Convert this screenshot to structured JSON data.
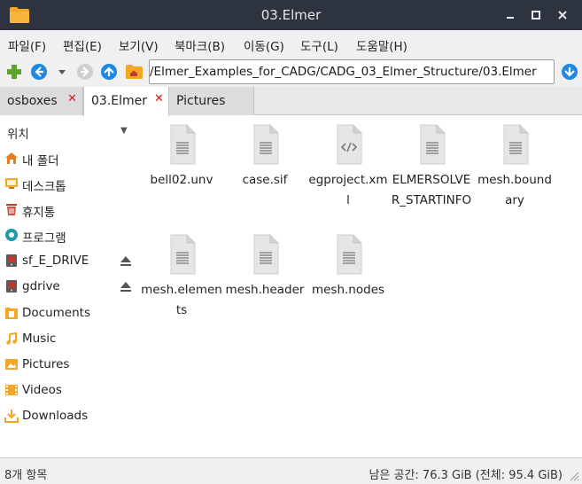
{
  "window": {
    "title": "03.Elmer"
  },
  "menu": [
    "파일(F)",
    "편집(E)",
    "보기(V)",
    "북마크(B)",
    "이동(G)",
    "도구(L)",
    "도움말(H)"
  ],
  "path": {
    "value": "/Elmer_Examples_for_CADG/CADG_03_Elmer_Structure/03.Elmer"
  },
  "tabs": [
    {
      "label": "osboxes",
      "close": "✕"
    },
    {
      "label": "03.Elmer",
      "close": "✕"
    },
    {
      "label": "Pictures",
      "close": ""
    }
  ],
  "sidebar": {
    "header": "위치",
    "items": [
      {
        "label": "내 폴더",
        "icon": "home-icon"
      },
      {
        "label": "데스크톱",
        "icon": "desktop-icon"
      },
      {
        "label": "휴지통",
        "icon": "trash-icon"
      },
      {
        "label": "프로그램",
        "icon": "applications-icon"
      },
      {
        "label": "sf_E_DRIVE",
        "icon": "drive-icon"
      },
      {
        "label": "gdrive",
        "icon": "drive-icon"
      },
      {
        "label": "Documents",
        "icon": "documents-folder-icon"
      },
      {
        "label": "Music",
        "icon": "music-folder-icon"
      },
      {
        "label": "Pictures",
        "icon": "pictures-folder-icon"
      },
      {
        "label": "Videos",
        "icon": "videos-folder-icon"
      },
      {
        "label": "Downloads",
        "icon": "downloads-folder-icon"
      }
    ]
  },
  "files": [
    {
      "name": "bell02.unv",
      "icon": "text-file-icon"
    },
    {
      "name": "case.sif",
      "icon": "text-file-icon"
    },
    {
      "name": "egproject.xml",
      "icon": "xml-file-icon"
    },
    {
      "name": "ELMERSOLVER_STARTINFO",
      "icon": "text-file-icon"
    },
    {
      "name": "mesh.boundary",
      "icon": "text-file-icon"
    },
    {
      "name": "mesh.elements",
      "icon": "text-file-icon"
    },
    {
      "name": "mesh.header",
      "icon": "text-file-icon"
    },
    {
      "name": "mesh.nodes",
      "icon": "text-file-icon"
    }
  ],
  "status": {
    "count": "8개 항목",
    "space": "남은 공간: 76.3 GiB (전체: 95.4 GiB)"
  },
  "colors": {
    "titlebar": "#2d3440",
    "folder": "#f5a623",
    "accent_blue": "#1e88e5",
    "close_red": "#d02020"
  }
}
